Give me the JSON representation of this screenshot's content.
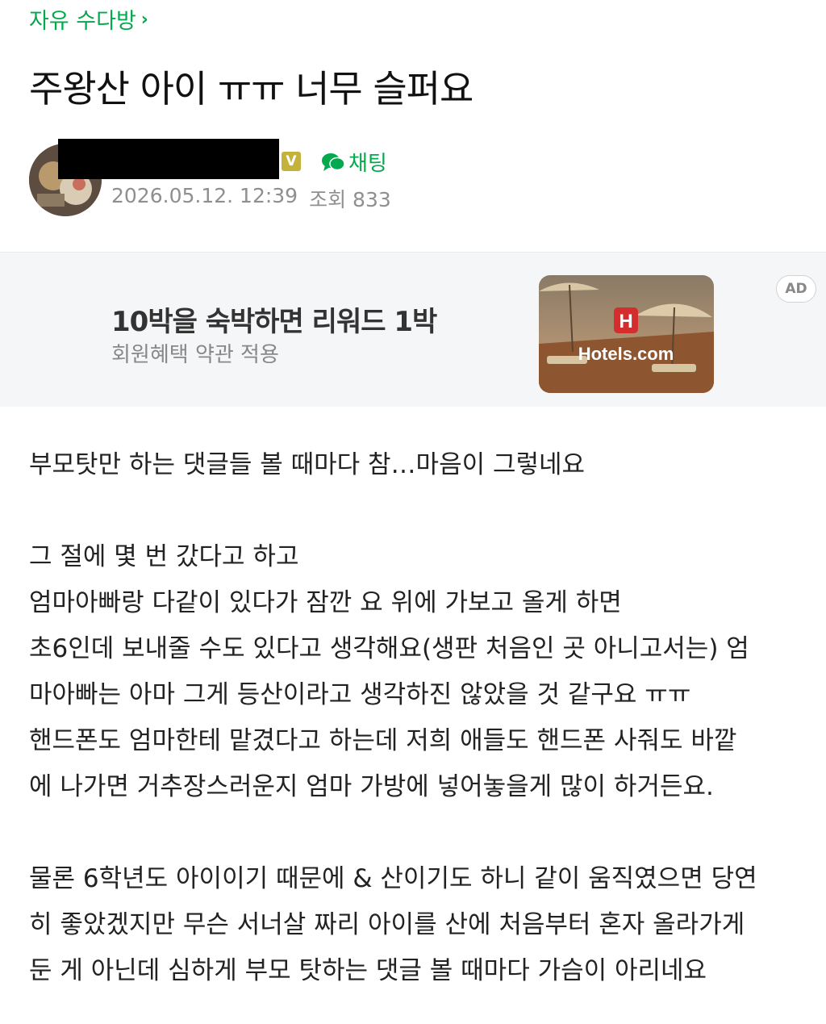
{
  "category": {
    "label": "자유 수다방",
    "chevron_icon": "chevron-right-icon"
  },
  "post": {
    "title": "주왕산 아이 ㅠㅠ 너무 슬퍼요"
  },
  "author": {
    "level_badge": "V",
    "chat_label": "채팅",
    "chat_icon": "speech-bubble-icon",
    "date": "2026.05.12. 12:39",
    "views": "조회 833"
  },
  "ad": {
    "headline": "10박을 숙박하면 리워드 1박",
    "subtext": "회원혜택 약관 적용",
    "badge": "AD",
    "brand": "Hotels.com",
    "brand_mark": "H"
  },
  "content": {
    "paragraphs": [
      [
        "부모탓만 하는 댓글들 볼 때마다 참…마음이 그렇네요"
      ],
      [
        "그 절에 몇 번 갔다고 하고",
        "엄마아빠랑 다같이 있다가 잠깐 요 위에 가보고 올게 하면",
        "초6인데 보내줄 수도 있다고 생각해요(생판 처음인 곳 아니고서는) 엄",
        "마아빠는 아마 그게 등산이라고 생각하진 않았을 것 같구요 ㅠㅠ",
        "핸드폰도 엄마한테 맡겼다고 하는데 저희 애들도 핸드폰 사줘도 바깥",
        "에 나가면 거추장스러운지 엄마 가방에 넣어놓을게 많이 하거든요."
      ],
      [
        "물론 6학년도 아이이기 때문에 & 산이기도 하니 같이 움직였으면 당연",
        "히 좋았겠지만 무슨 서너살 짜리 아이를 산에 처음부터 혼자 올라가게",
        "둔 게 아닌데 심하게 부모 탓하는 댓글 볼 때마다 가슴이 아리네요"
      ]
    ]
  },
  "colors": {
    "accent": "#03a94d",
    "meta": "#8f8f8f",
    "ad_bg": "#f5f6f8"
  }
}
